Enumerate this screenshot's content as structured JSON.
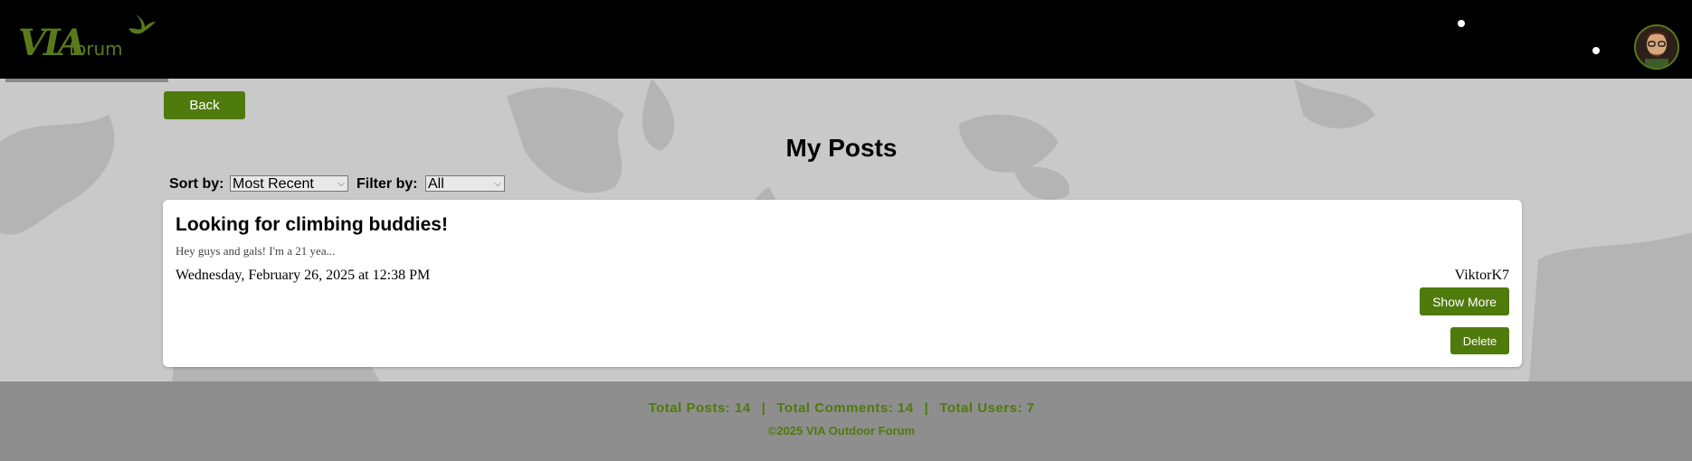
{
  "header": {
    "logo_text_main": "VIA",
    "logo_text_sub": "forum",
    "avatar_icon": "user-avatar-icon"
  },
  "nav": {
    "back_label": "Back"
  },
  "page": {
    "title": "My Posts"
  },
  "controls": {
    "sort_label": "Sort by:",
    "sort_value": "Most Recent",
    "filter_label": "Filter by:",
    "filter_value": "All"
  },
  "posts": [
    {
      "title": "Looking for climbing buddies!",
      "excerpt": "Hey guys and gals! I'm a 21 yea...",
      "date": "Wednesday, February 26, 2025 at 12:38 PM",
      "author": "ViktorK7",
      "show_more_label": "Show More",
      "delete_label": "Delete"
    }
  ],
  "footer": {
    "total_posts": "Total Posts: 14",
    "total_comments": "Total Comments: 14",
    "total_users": "Total Users: 7",
    "separator": "|",
    "copyright": "©2025 VIA Outdoor Forum"
  },
  "colors": {
    "accent": "#4f7a0c",
    "header_bg": "#000000",
    "footer_bg": "#8e8e8e",
    "page_bg": "#c9c9c9"
  }
}
